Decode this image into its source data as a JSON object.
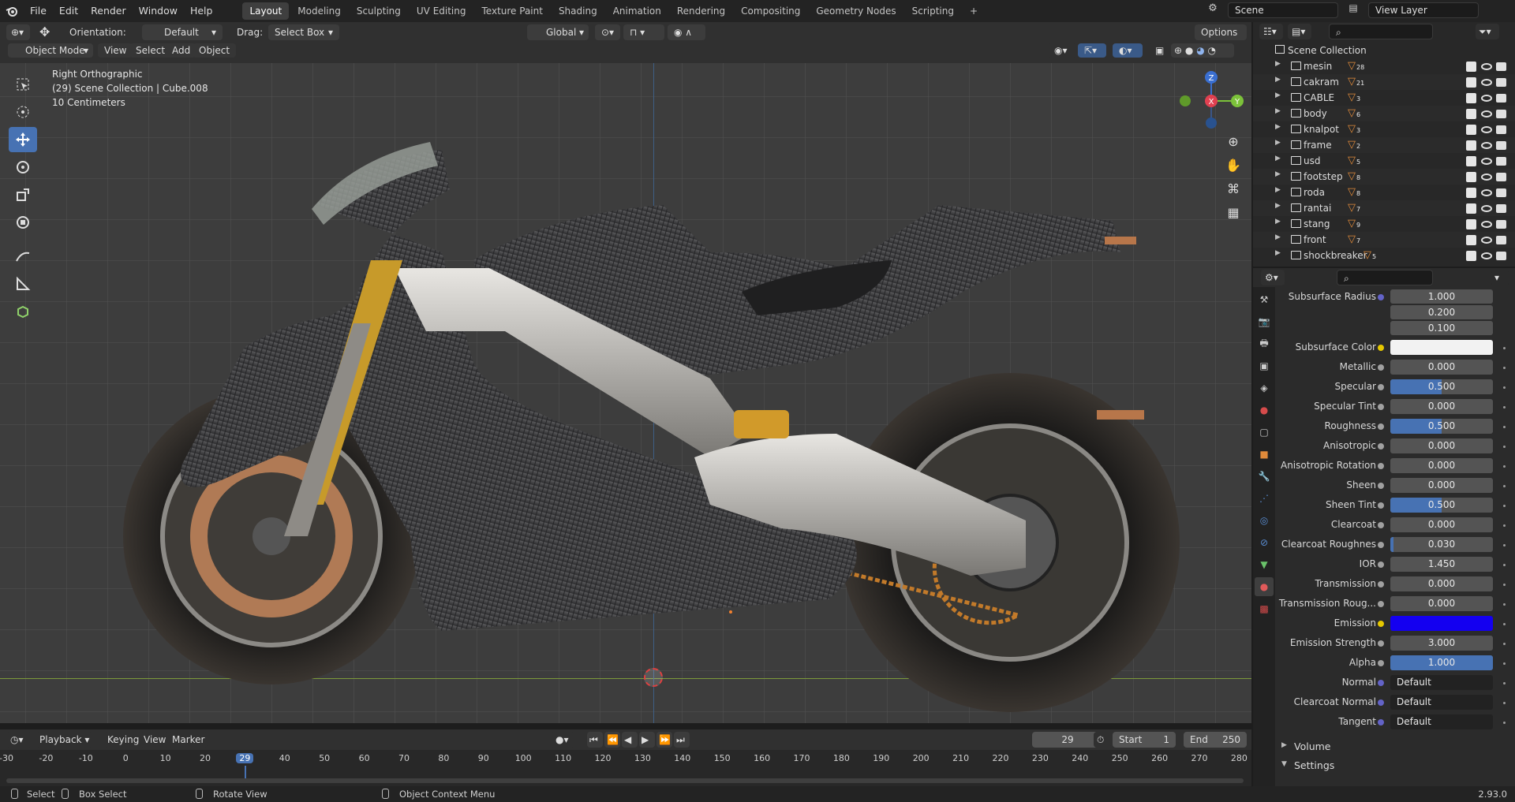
{
  "topbar": {
    "menus": [
      "File",
      "Edit",
      "Render",
      "Window",
      "Help"
    ],
    "workspaces": [
      "Layout",
      "Modeling",
      "Sculpting",
      "UV Editing",
      "Texture Paint",
      "Shading",
      "Animation",
      "Rendering",
      "Compositing",
      "Geometry Nodes",
      "Scripting"
    ],
    "active_workspace": "Layout",
    "add_tab": "+",
    "scene": "Scene",
    "view_layer": "View Layer"
  },
  "vp_header": {
    "orientation_label": "Orientation:",
    "orientation_value": "Default",
    "drag_label": "Drag:",
    "drag_value": "Select Box",
    "transform_orientation": "Global",
    "options": "Options",
    "mode": "Object Mode",
    "view": "View",
    "select": "Select",
    "add": "Add",
    "object": "Object"
  },
  "viewport": {
    "view_name": "Right Orthographic",
    "collection": "(29) Scene Collection | Cube.008",
    "scale": "10 Centimeters",
    "gizmo": {
      "z": "Z",
      "x": "X",
      "y": "Y"
    }
  },
  "outliner": {
    "root": "Scene Collection",
    "items": [
      {
        "name": "mesin",
        "count": "28"
      },
      {
        "name": "cakram",
        "count": "21"
      },
      {
        "name": "CABLE",
        "count": "3"
      },
      {
        "name": "body",
        "count": "6"
      },
      {
        "name": "knalpot",
        "count": "3"
      },
      {
        "name": "frame",
        "count": "2"
      },
      {
        "name": "usd",
        "count": "5"
      },
      {
        "name": "footstep",
        "count": "8"
      },
      {
        "name": "roda",
        "count": "8"
      },
      {
        "name": "rantai",
        "count": "7"
      },
      {
        "name": "stang",
        "count": "9"
      },
      {
        "name": "front",
        "count": "7"
      },
      {
        "name": "shockbreaker",
        "count": "5"
      }
    ]
  },
  "properties": {
    "subsurface_radius": {
      "label": "Subsurface Radius",
      "values": [
        "1.000",
        "0.200",
        "0.100"
      ]
    },
    "rows": [
      {
        "label": "Subsurface Color",
        "value": "",
        "kind": "color",
        "color": "#f2f2f2",
        "dot": "#e6c800"
      },
      {
        "label": "Metallic",
        "value": "0.000",
        "fill": 0
      },
      {
        "label": "Specular",
        "value": "0.500",
        "fill": 0.5
      },
      {
        "label": "Specular Tint",
        "value": "0.000",
        "fill": 0
      },
      {
        "label": "Roughness",
        "value": "0.500",
        "fill": 0.5
      },
      {
        "label": "Anisotropic",
        "value": "0.000",
        "fill": 0
      },
      {
        "label": "Anisotropic Rotation",
        "value": "0.000",
        "fill": 0
      },
      {
        "label": "Sheen",
        "value": "0.000",
        "fill": 0
      },
      {
        "label": "Sheen Tint",
        "value": "0.500",
        "fill": 0.5
      },
      {
        "label": "Clearcoat",
        "value": "0.000",
        "fill": 0
      },
      {
        "label": "Clearcoat Roughnes",
        "value": "0.030",
        "fill": 0.03
      },
      {
        "label": "IOR",
        "value": "1.450",
        "fill": 0
      },
      {
        "label": "Transmission",
        "value": "0.000",
        "fill": 0
      },
      {
        "label": "Transmission Roug...",
        "value": "0.000",
        "fill": 0
      },
      {
        "label": "Emission",
        "value": "",
        "kind": "color",
        "color": "#1400f0",
        "dot": "#e6c800"
      },
      {
        "label": "Emission Strength",
        "value": "3.000",
        "fill": 0
      },
      {
        "label": "Alpha",
        "value": "1.000",
        "fill": 1
      },
      {
        "label": "Normal",
        "value": "Default",
        "kind": "link",
        "dot": "#6363c7"
      },
      {
        "label": "Clearcoat Normal",
        "value": "Default",
        "kind": "link",
        "dot": "#6363c7"
      },
      {
        "label": "Tangent",
        "value": "Default",
        "kind": "link",
        "dot": "#6363c7"
      }
    ],
    "panels": [
      "Volume",
      "Settings"
    ]
  },
  "timeline": {
    "menus": [
      "Playback",
      "Keying",
      "View",
      "Marker"
    ],
    "current_frame": "29",
    "start_label": "Start",
    "start": "1",
    "end_label": "End",
    "end": "250",
    "ticks": [
      "-30",
      "-20",
      "-10",
      "0",
      "10",
      "20",
      "29",
      "40",
      "50",
      "60",
      "70",
      "80",
      "90",
      "100",
      "110",
      "120",
      "130",
      "140",
      "150",
      "160",
      "170",
      "180",
      "190",
      "200",
      "210",
      "220",
      "230",
      "240",
      "250",
      "260",
      "270",
      "280"
    ]
  },
  "statusbar": {
    "select": "Select",
    "box_select": "Box Select",
    "rotate_view": "Rotate View",
    "context_menu": "Object Context Menu",
    "version": "2.93.0"
  },
  "colors": {
    "accent": "#4772b3",
    "active_frame": "#4772b3",
    "emission": "#1400f0"
  }
}
